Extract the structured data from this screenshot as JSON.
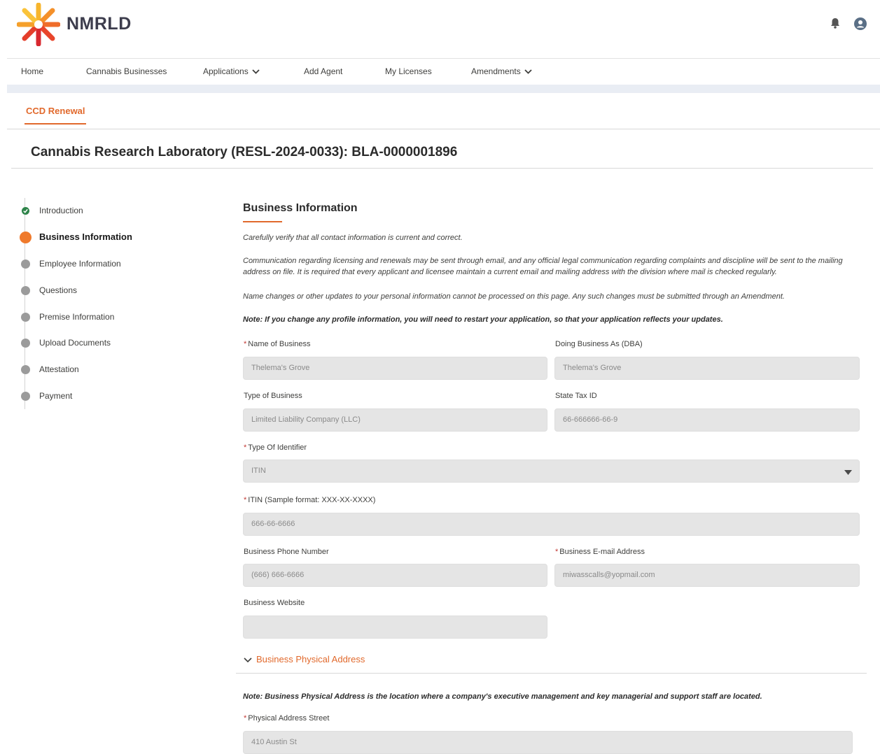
{
  "header": {
    "logo_text": "NMRLD",
    "icons": [
      "bell-icon",
      "user-avatar-icon"
    ]
  },
  "nav": {
    "items": [
      {
        "label": "Home"
      },
      {
        "label": "Cannabis Businesses"
      },
      {
        "label": "Applications",
        "dropdown": true
      },
      {
        "label": "Add Agent"
      },
      {
        "label": "My Licenses"
      },
      {
        "label": "Amendments",
        "dropdown": true
      }
    ]
  },
  "tabs": {
    "active_label": "CCD Renewal"
  },
  "page_title": "Cannabis Research Laboratory (RESL-2024-0033): BLA-0000001896",
  "steps": [
    {
      "label": "Introduction",
      "state": "complete"
    },
    {
      "label": "Business Information",
      "state": "current"
    },
    {
      "label": "Employee Information",
      "state": "pending"
    },
    {
      "label": "Questions",
      "state": "pending"
    },
    {
      "label": "Premise Information",
      "state": "pending"
    },
    {
      "label": "Upload Documents",
      "state": "pending"
    },
    {
      "label": "Attestation",
      "state": "pending"
    },
    {
      "label": "Payment",
      "state": "pending"
    }
  ],
  "section": {
    "title": "Business Information",
    "para1": "Carefully verify that all contact information is current and correct.",
    "para2": "Communication regarding licensing and renewals may be sent through email, and any official legal communication regarding complaints and discipline will be sent to the mailing address on file. It is required that every applicant and licensee maintain a current email and mailing address with the division where mail is checked regularly.",
    "para3": "Name changes or other updates to your personal information cannot be processed on this page. Any such changes must be submitted through an Amendment.",
    "note": "Note: If you change any profile information, you will need to restart your application, so that your application reflects your updates."
  },
  "required_marker": "*",
  "fields": {
    "name_of_business": {
      "label": "Name of Business",
      "required": true,
      "value": "Thelema's Grove"
    },
    "dba": {
      "label": "Doing Business As (DBA)",
      "required": false,
      "value": "Thelema's Grove"
    },
    "type_of_business": {
      "label": "Type of Business",
      "required": false,
      "value": "Limited Liability Company (LLC)"
    },
    "state_tax_id": {
      "label": "State Tax ID",
      "required": false,
      "value": "66-666666-66-9"
    },
    "type_of_identifier": {
      "label": "Type Of Identifier",
      "required": true,
      "value": "ITIN"
    },
    "itin": {
      "label": "ITIN (Sample format: XXX-XX-XXXX)",
      "required": true,
      "value": "666-66-6666"
    },
    "business_phone": {
      "label": "Business Phone Number",
      "required": false,
      "value": "(666) 666-6666"
    },
    "business_email": {
      "label": "Business E-mail Address",
      "required": true,
      "value": "miwasscalls@yopmail.com"
    },
    "business_website": {
      "label": "Business Website",
      "required": false,
      "value": ""
    }
  },
  "physical_address": {
    "heading": "Business Physical Address",
    "note": "Note: Business Physical Address is the location where a company's executive management and key managerial and support staff are located.",
    "street": {
      "label": "Physical Address Street",
      "required": true,
      "value": "410 Austin St"
    }
  },
  "colors": {
    "accent": "#e1692c",
    "complete": "#2e844a",
    "current": "#ef7a2c",
    "pending": "#9b9b9b",
    "field_bg": "#e5e5e5"
  }
}
